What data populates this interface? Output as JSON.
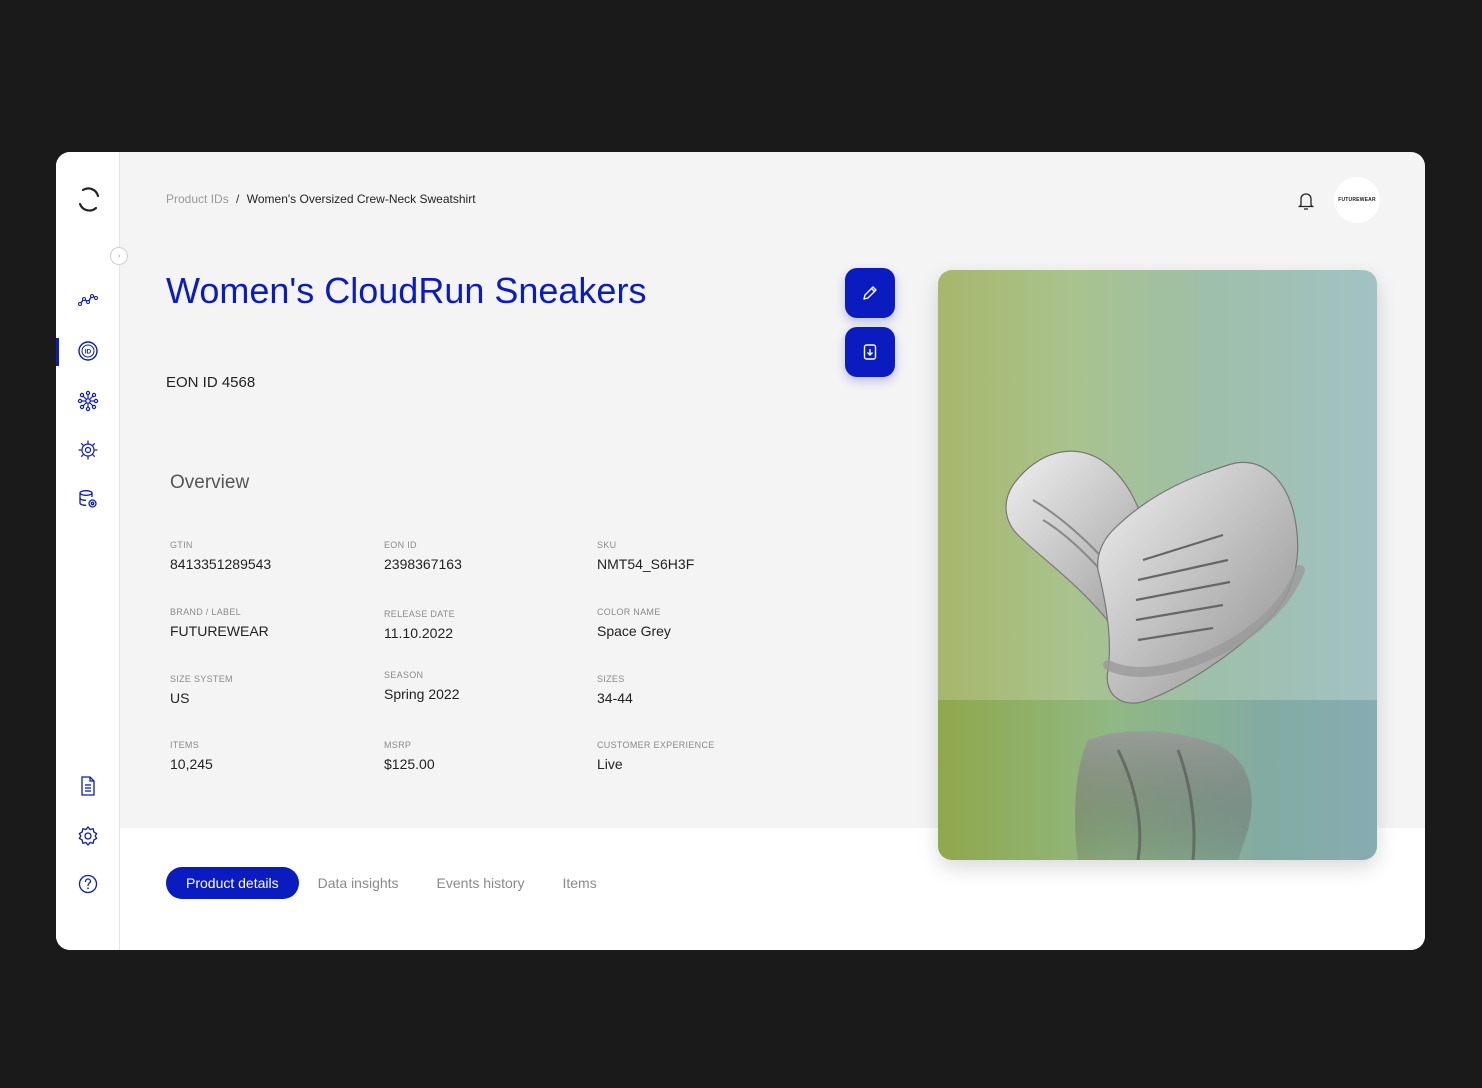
{
  "breadcrumb": {
    "parent": "Product IDs",
    "separator": "/",
    "current": "Women's Oversized Crew-Neck Sweatshirt"
  },
  "header": {
    "avatar_label": "FUTUREWEAR"
  },
  "product": {
    "title": "Women's CloudRun Sneakers",
    "eon_id_label": "EON ID 4568"
  },
  "overview": {
    "title": "Overview",
    "fields": [
      {
        "label": "GTIN",
        "value": "8413351289543"
      },
      {
        "label": "EON ID",
        "value": "2398367163"
      },
      {
        "label": "SKU",
        "value": "NMT54_S6H3F"
      },
      {
        "label": "BRAND / LABEL",
        "value": "FUTUREWEAR"
      },
      {
        "label": "RELEASE DATE",
        "value": "11.10.2022"
      },
      {
        "label": "COLOR NAME",
        "value": "Space Grey"
      },
      {
        "label": "SIZE SYSTEM",
        "value": "US"
      },
      {
        "label": "SEASON",
        "value": "Spring 2022"
      },
      {
        "label": "SIZES",
        "value": "34-44"
      },
      {
        "label": "ITEMS",
        "value": "10,245"
      },
      {
        "label": "MSRP",
        "value": "$125.00"
      },
      {
        "label": "CUSTOMER EXPERIENCE",
        "value": "Live"
      }
    ]
  },
  "tabs": [
    {
      "label": "Product details",
      "active": true
    },
    {
      "label": "Data insights"
    },
    {
      "label": "Events history"
    },
    {
      "label": "Items"
    }
  ],
  "sidebar": {
    "items": [
      {
        "icon": "analytics-icon"
      },
      {
        "icon": "id-icon",
        "active": true
      },
      {
        "icon": "network-icon"
      },
      {
        "icon": "settings-gear-icon"
      },
      {
        "icon": "database-icon"
      },
      {
        "icon": "document-icon"
      },
      {
        "icon": "settings-icon"
      },
      {
        "icon": "help-icon"
      }
    ]
  },
  "colors": {
    "accent": "#0a1cc0",
    "background": "#f4f4f4",
    "page": "#1a1a1a"
  }
}
